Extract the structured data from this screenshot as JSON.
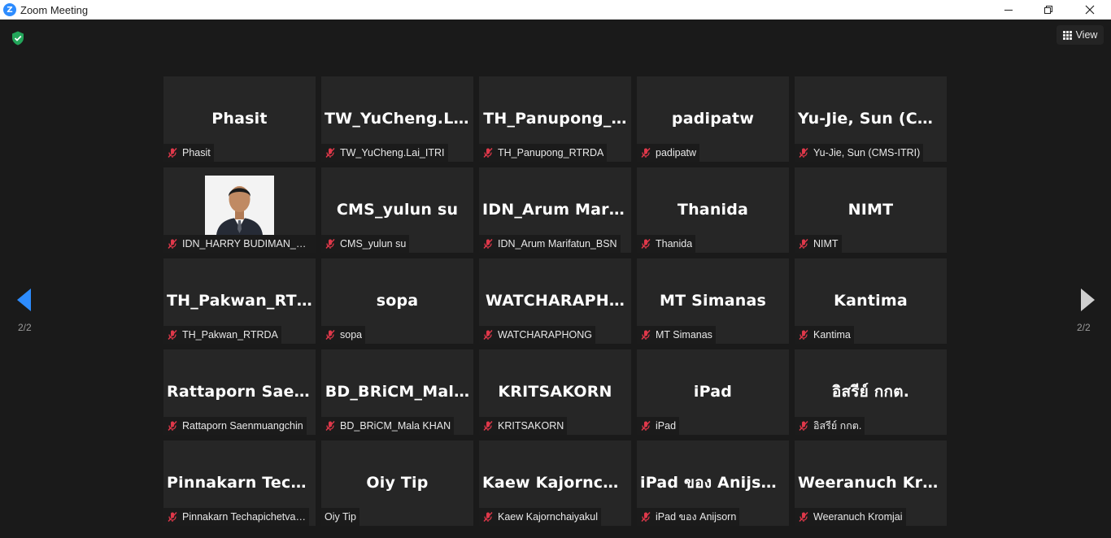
{
  "window": {
    "title": "Zoom Meeting",
    "logo_letter": "Z"
  },
  "toolbar": {
    "view_label": "View"
  },
  "pager": {
    "left": "2/2",
    "right": "2/2"
  },
  "participants": [
    {
      "display": "Phasit",
      "name": "Phasit",
      "muted": true
    },
    {
      "display": "TW_YuCheng.La…",
      "name": "TW_YuCheng.Lai_ITRI",
      "muted": true
    },
    {
      "display": "TH_Panupong_…",
      "name": "TH_Panupong_RTRDA",
      "muted": true
    },
    {
      "display": "padipatw",
      "name": "padipatw",
      "muted": true
    },
    {
      "display": "Yu-Jie, Sun (CM…",
      "name": "Yu-Jie, Sun (CMS-ITRI)",
      "muted": true
    },
    {
      "display": "",
      "name": "IDN_HARRY BUDIMAN_S…",
      "muted": true,
      "photo": true
    },
    {
      "display": "CMS_yulun su",
      "name": "CMS_yulun su",
      "muted": true
    },
    {
      "display": "IDN_Arum Mari…",
      "name": "IDN_Arum Marifatun_BSN",
      "muted": true
    },
    {
      "display": "Thanida",
      "name": "Thanida",
      "muted": true
    },
    {
      "display": "NIMT",
      "name": "NIMT",
      "muted": true
    },
    {
      "display": "TH_Pakwan_RT…",
      "name": "TH_Pakwan_RTRDA",
      "muted": true
    },
    {
      "display": "sopa",
      "name": "sopa",
      "muted": true
    },
    {
      "display": "WATCHARAPH…",
      "name": "WATCHARAPHONG",
      "muted": true
    },
    {
      "display": "MT Simanas",
      "name": "MT Simanas",
      "muted": true
    },
    {
      "display": "Kantima",
      "name": "Kantima",
      "muted": true
    },
    {
      "display": "Rattaporn Saen…",
      "name": "Rattaporn Saenmuangchin",
      "muted": true
    },
    {
      "display": "BD_BRiCM_Mal…",
      "name": "BD_BRiCM_Mala KHAN",
      "muted": true
    },
    {
      "display": "KRITSAKORN",
      "name": "KRITSAKORN",
      "muted": true
    },
    {
      "display": "iPad",
      "name": "iPad",
      "muted": true
    },
    {
      "display": "อิสรีย์ กกต.",
      "name": "อิสรีย์ กกต.",
      "muted": true
    },
    {
      "display": "Pinnakarn Tech…",
      "name": "Pinnakarn Techapichetva…",
      "muted": true
    },
    {
      "display": "Oiy Tip",
      "name": "Oiy Tip",
      "muted": false
    },
    {
      "display": "Kaew Kajorncha…",
      "name": "Kaew Kajornchaiyakul",
      "muted": true
    },
    {
      "display": "iPad ของ Anijsorn",
      "name": "iPad ของ Anijsorn",
      "muted": true
    },
    {
      "display": "Weeranuch Kro…",
      "name": "Weeranuch Kromjai",
      "muted": true
    }
  ],
  "colors": {
    "accent": "#2d8cff",
    "muted_mic": "#e0384a",
    "secure": "#23a55a"
  }
}
